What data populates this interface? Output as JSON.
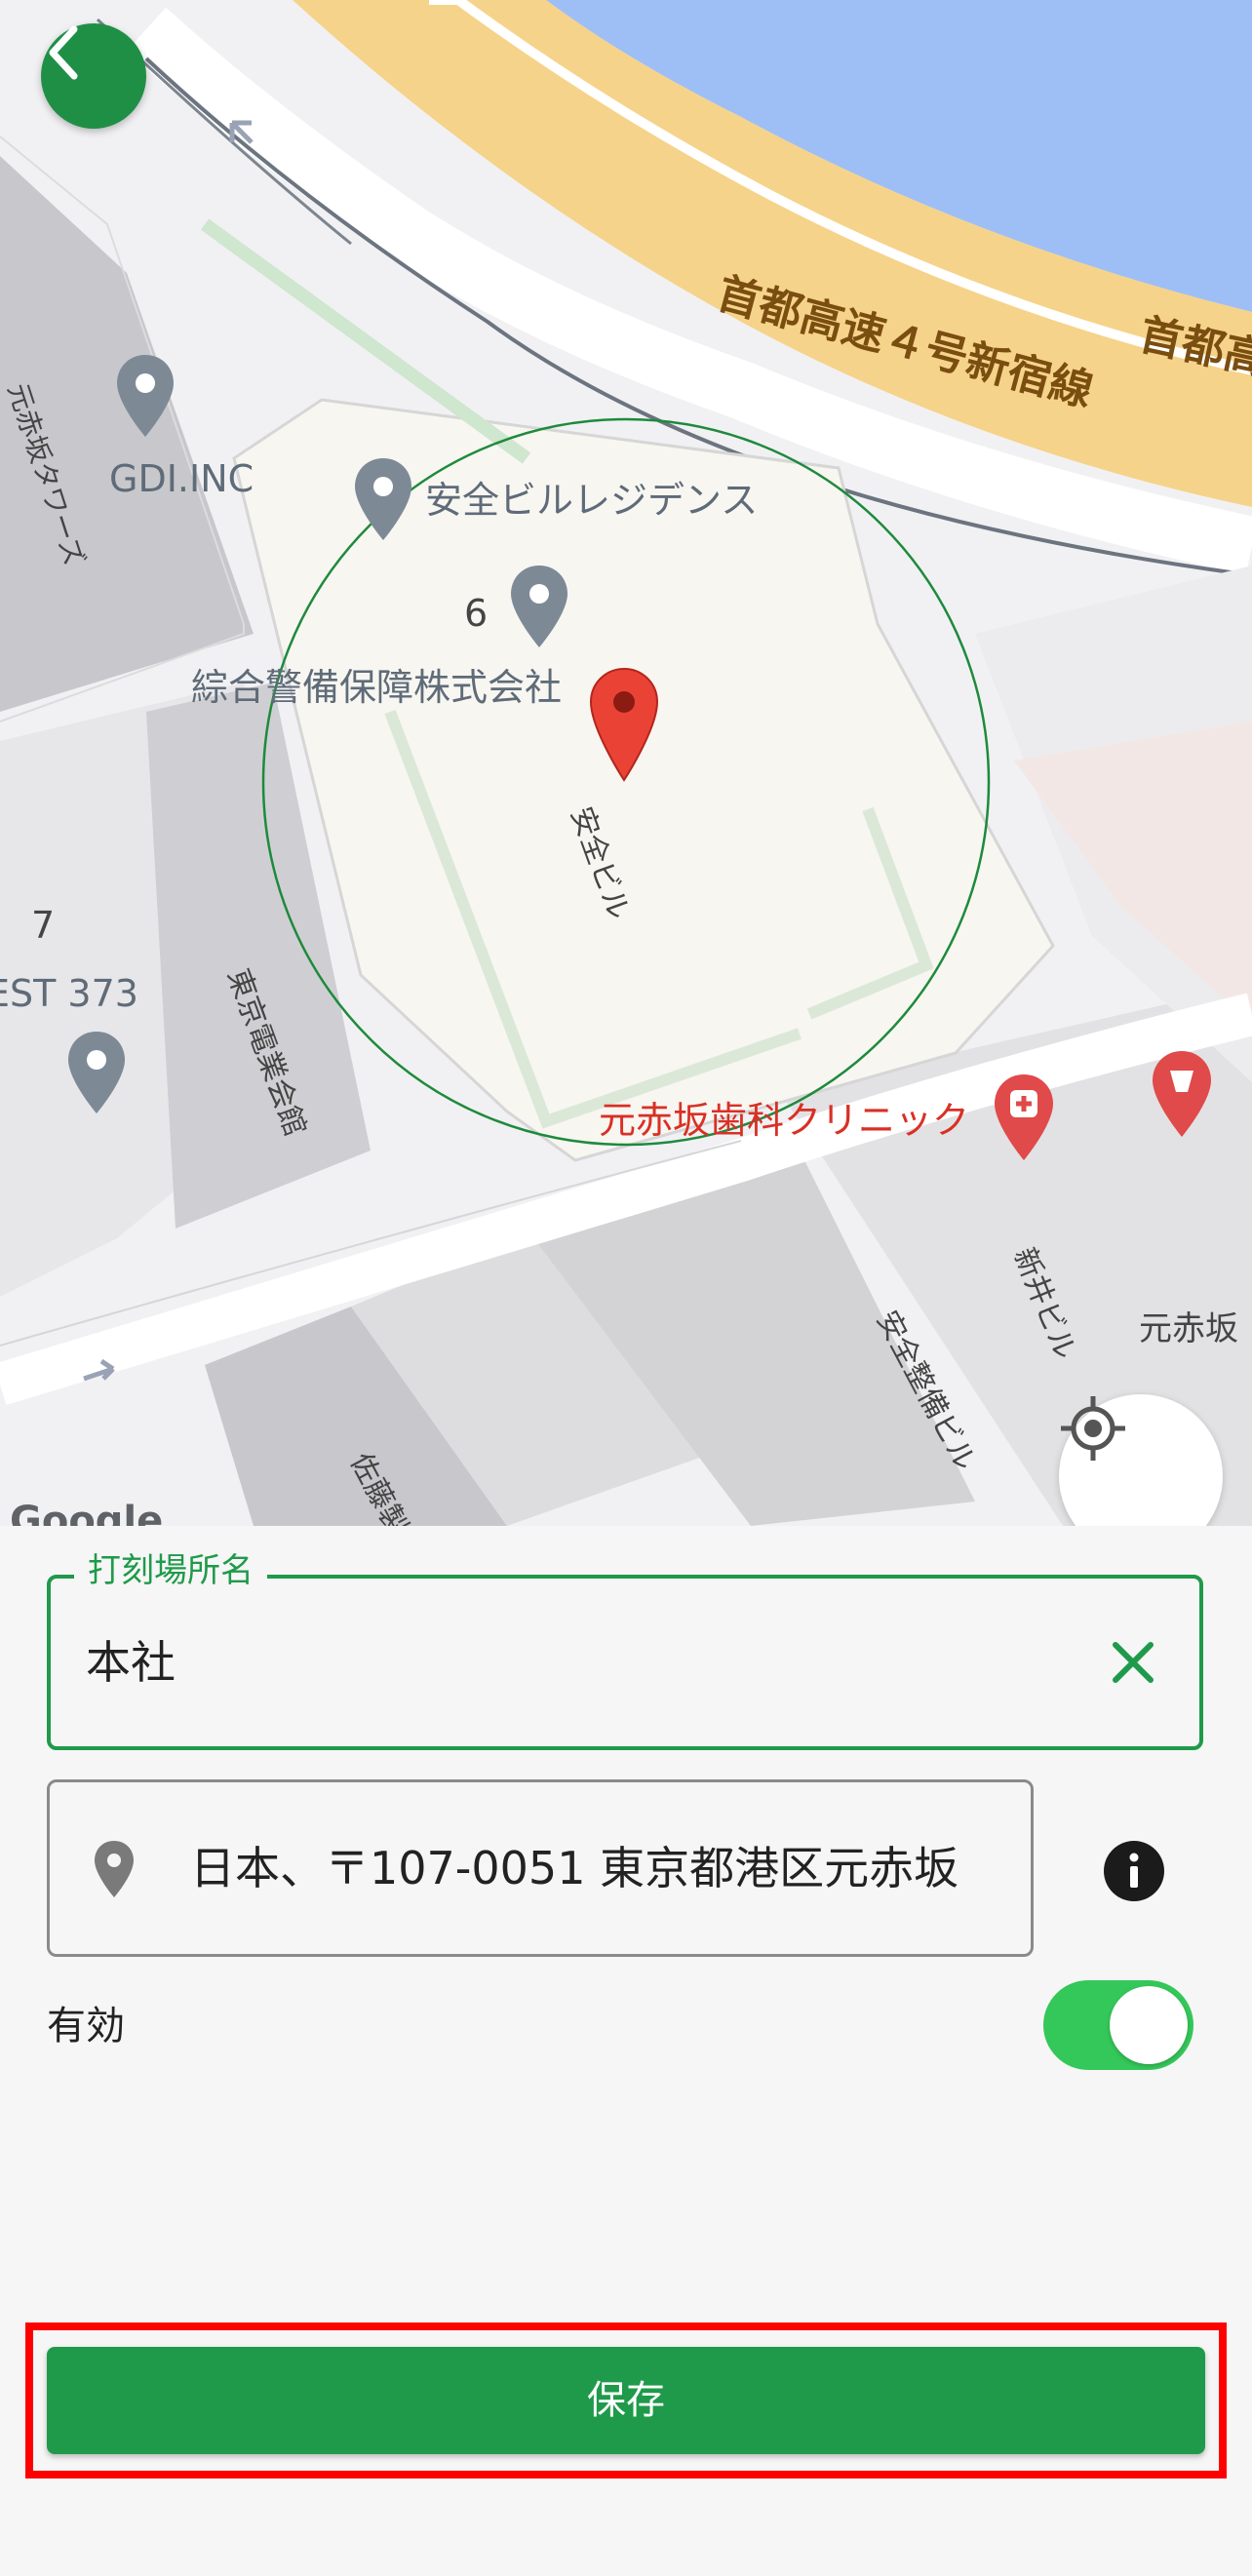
{
  "map": {
    "labels": {
      "expressway_1": "首都高速４号新宿線",
      "expressway_2": "首都高",
      "gdi": "GDI.INC",
      "residence": "安全ビルレジデンス",
      "number_6": "6",
      "sogo_keibi": "綜合警備保障株式会社",
      "anzen_bldg": "安全ビル",
      "number_7": "7",
      "est_373": "EST 373",
      "tokyo_denki": "東京電業会館",
      "motoakasaka_tower": "元赤坂タワーズ",
      "dental_clinic": "元赤坂歯科クリニック",
      "shinjo_bldg": "新井ビル",
      "motoakasaka": "元赤坂",
      "anzen_seibi": "安全整備ビル",
      "sato_bldg": "佐藤製",
      "google": "Google"
    },
    "radius_circle_color": "#1e8a3c",
    "pin_color": "#ea4335"
  },
  "form": {
    "name_field": {
      "label": "打刻場所名",
      "value": "本社"
    },
    "address_field": {
      "value": "日本、〒107-0051 東京都港区元赤坂"
    },
    "enabled": {
      "label": "有効",
      "on": true
    },
    "save_label": "保存"
  },
  "colors": {
    "accent": "#1f9a4a",
    "toggle_on": "#34c759",
    "highlight": "#ff0000"
  }
}
